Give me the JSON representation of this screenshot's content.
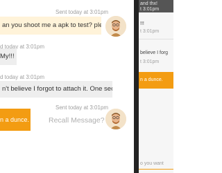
{
  "chat": {
    "messages": [
      {
        "direction": "outgoing",
        "timestamp": "Sent today at 3:01pm",
        "text": "an you shoot me a apk to test? please"
      },
      {
        "direction": "incoming",
        "timestamp": "d today at 3:01pm",
        "text": "My!!!"
      },
      {
        "direction": "incoming",
        "timestamp": "d today at 3:01pm",
        "text": "n't believe I forgot to attach it. One sec"
      },
      {
        "direction": "outgoing",
        "timestamp": "Sent today at 3:01pm",
        "text": "n a dunce."
      }
    ],
    "recall_label": "Recall Message?"
  },
  "phone": {
    "header_line1": "and thx!",
    "header_line2": "t 3:01pm",
    "lines": [
      "!!!",
      "t 3:01pm",
      "believe I forg",
      "t 3:01pm"
    ],
    "orange_text": "n a dunce.",
    "input_placeholder": "o you want"
  },
  "colors": {
    "accent": "#f39c12",
    "outgoing_bubble": "#fff3d9",
    "incoming_bubble": "#eeeeee"
  }
}
